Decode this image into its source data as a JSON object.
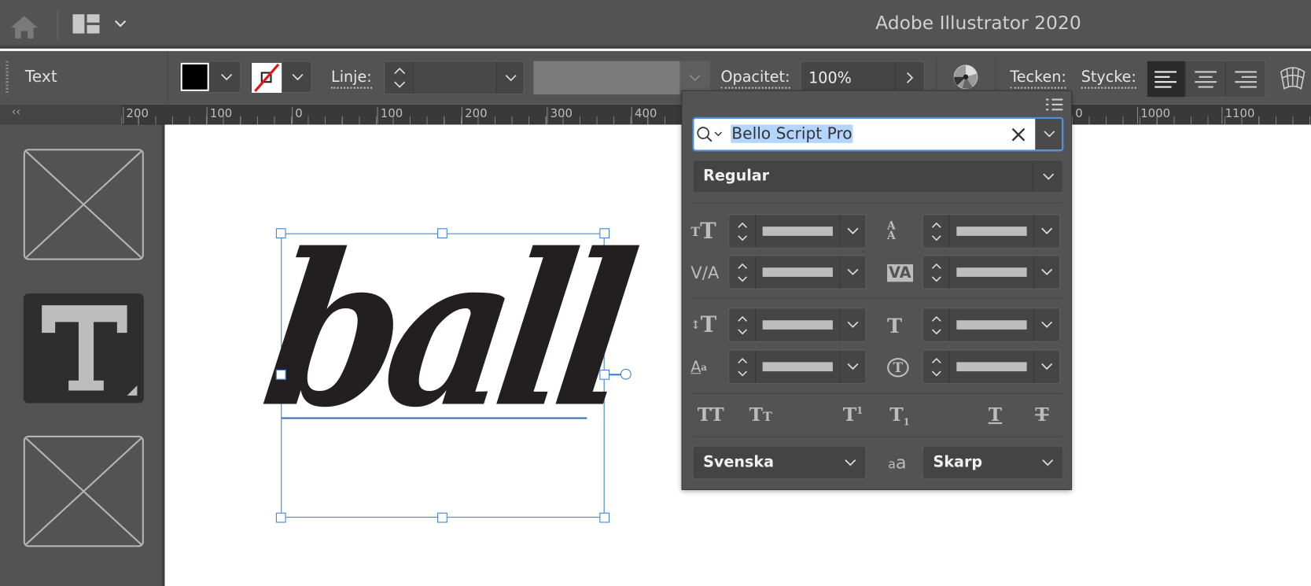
{
  "app": {
    "title": "Adobe Illustrator 2020"
  },
  "control_bar": {
    "tool_label": "Text",
    "fill_color": "#000000",
    "stroke": "none",
    "stroke_label": "Linje:",
    "opacity_label": "Opacitet:",
    "opacity_value": "100%",
    "character_label": "Tecken:",
    "paragraph_label": "Stycke:",
    "align_options": [
      "align-left",
      "align-center",
      "align-right"
    ],
    "active_align": "align-left"
  },
  "ruler": {
    "collapse": "‹‹",
    "labels": [
      "200",
      "100",
      "0",
      "100",
      "200",
      "300",
      "400",
      "0",
      "1000",
      "1100"
    ]
  },
  "canvas": {
    "text": "ball",
    "selection_color": "#3b7fd8"
  },
  "character_panel": {
    "font_family": "Bello Script Pro",
    "font_style": "Regular",
    "language": "Svenska",
    "anti_aliasing": "Skarp",
    "controls": [
      "font-size",
      "leading",
      "kerning",
      "tracking",
      "vertical-scale",
      "horizontal-scale",
      "baseline-shift",
      "character-rotation"
    ],
    "style_buttons": [
      "all-caps",
      "small-caps",
      "superscript",
      "subscript",
      "underline",
      "strikethrough"
    ]
  },
  "colors": {
    "chrome": "#535353",
    "accent": "#3b7fd8",
    "highlight": "#b4d5fe"
  }
}
